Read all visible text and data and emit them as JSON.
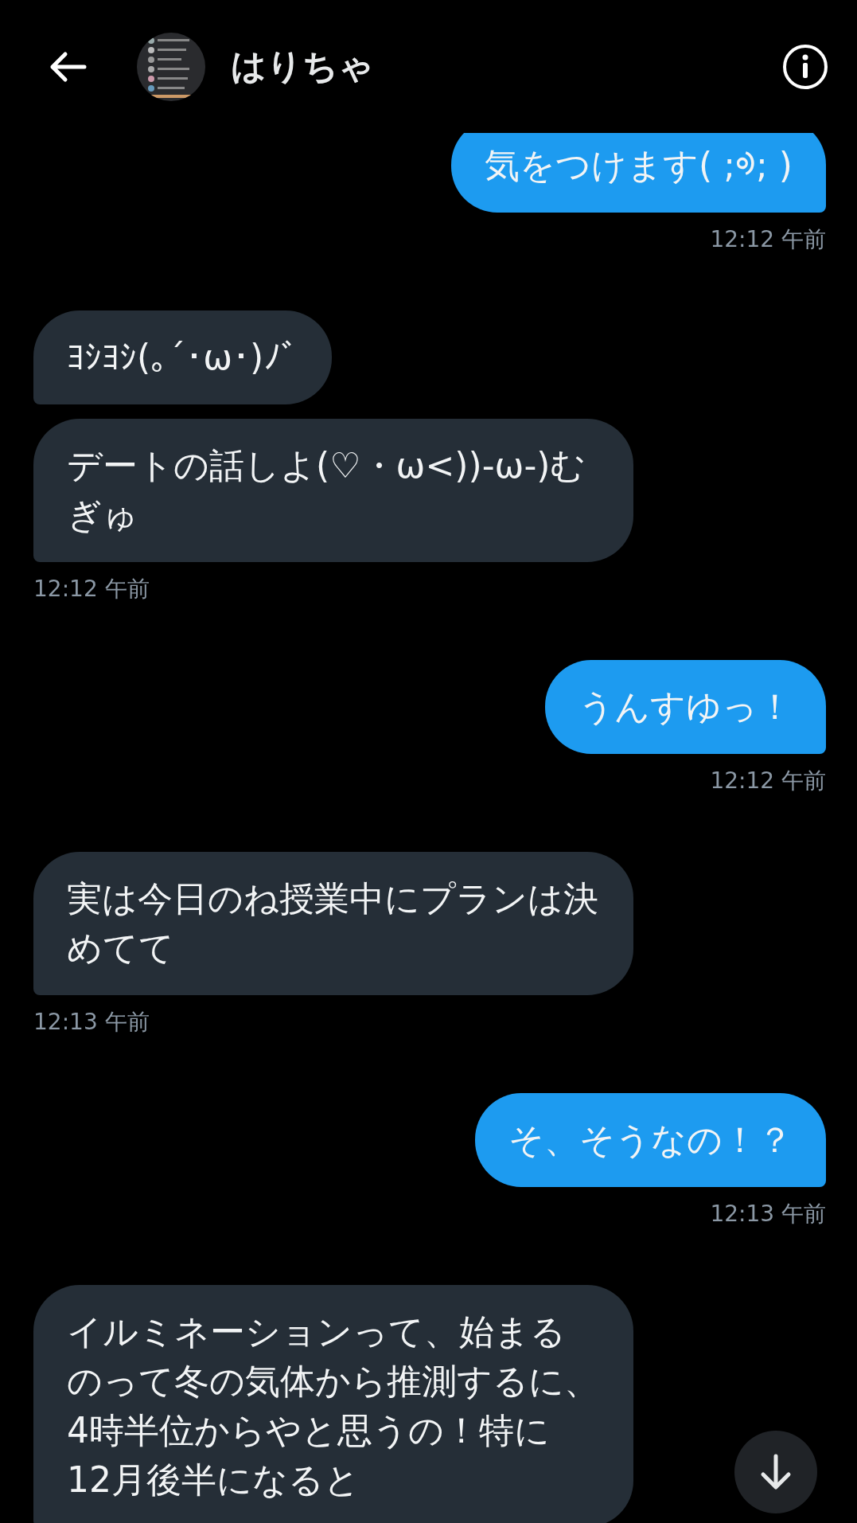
{
  "header": {
    "title": "はりちゃ"
  },
  "groups": [
    {
      "kind": "sent",
      "bubbles": [
        "気をつけます( ;ᢀ; )"
      ],
      "time": "12:12 午前"
    },
    {
      "kind": "received",
      "bubbles": [
        "ﾖｼﾖｼ(｡´･ω･)ﾉﾞ",
        "デートの話しよ(♡・ω<))-ω-)むぎゅ"
      ],
      "time": "12:12 午前"
    },
    {
      "kind": "sent",
      "bubbles": [
        "うんすゆっ！"
      ],
      "time": "12:12 午前"
    },
    {
      "kind": "received",
      "bubbles": [
        "実は今日のね授業中にプランは決めてて"
      ],
      "time": "12:13 午前"
    },
    {
      "kind": "sent",
      "bubbles": [
        "そ、そうなの！？"
      ],
      "time": "12:13 午前"
    },
    {
      "kind": "received",
      "bubbles": [
        "イルミネーションって、始まるのって冬の気体から推測するに、4時半位からやと思うの！特に12月後半になると"
      ]
    }
  ]
}
